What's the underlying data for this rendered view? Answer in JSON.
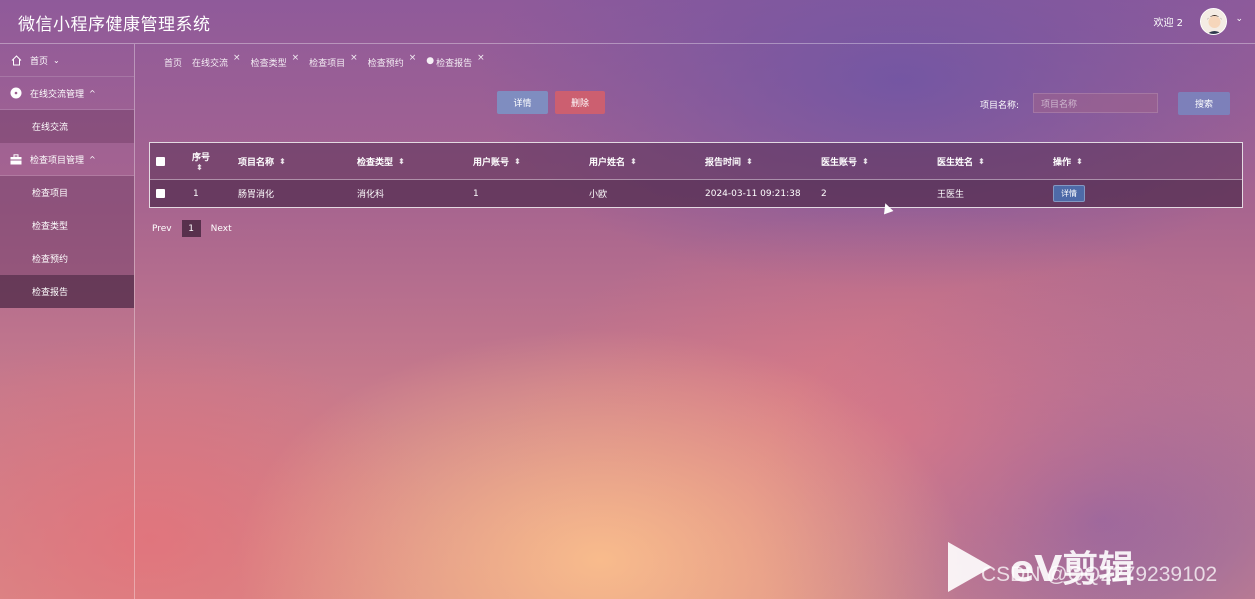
{
  "header": {
    "title": "微信小程序健康管理系统",
    "welcome": "欢迎 2"
  },
  "sidebar": {
    "groups": [
      {
        "label": "首页",
        "icon": "home-icon",
        "caret": "⌄"
      },
      {
        "label": "在线交流管理",
        "icon": "chat-icon",
        "caret": "^",
        "items": [
          "在线交流"
        ]
      },
      {
        "label": "检查项目管理",
        "icon": "briefcase-icon",
        "caret": "^",
        "items": [
          "检查项目",
          "检查类型",
          "检查预约",
          "检查报告"
        ]
      }
    ],
    "active_item": "检查报告"
  },
  "tabs": [
    {
      "label": "首页",
      "closable": false
    },
    {
      "label": "在线交流",
      "closable": true
    },
    {
      "label": "检查类型",
      "closable": true
    },
    {
      "label": "检查项目",
      "closable": true
    },
    {
      "label": "检查预约",
      "closable": true
    },
    {
      "label": "检查报告",
      "closable": true,
      "active": true
    }
  ],
  "toolbar": {
    "detail_label": "详情",
    "delete_label": "删除",
    "search_label": "项目名称:",
    "search_placeholder": "项目名称",
    "search_button": "搜索"
  },
  "table": {
    "columns": [
      "序号",
      "项目名称",
      "检查类型",
      "用户账号",
      "用户姓名",
      "报告时间",
      "医生账号",
      "医生姓名",
      "操作"
    ],
    "rows": [
      [
        "1",
        "肠胃消化",
        "消化科",
        "1",
        "小欧",
        "2024-03-11 09:21:38",
        "2",
        "王医生",
        "详情"
      ]
    ]
  },
  "pagination": {
    "prev": "Prev",
    "page": "1",
    "next": "Next"
  },
  "watermark": {
    "brand": "eV剪辑",
    "csdn": "CSDN @QQ2279239102"
  }
}
